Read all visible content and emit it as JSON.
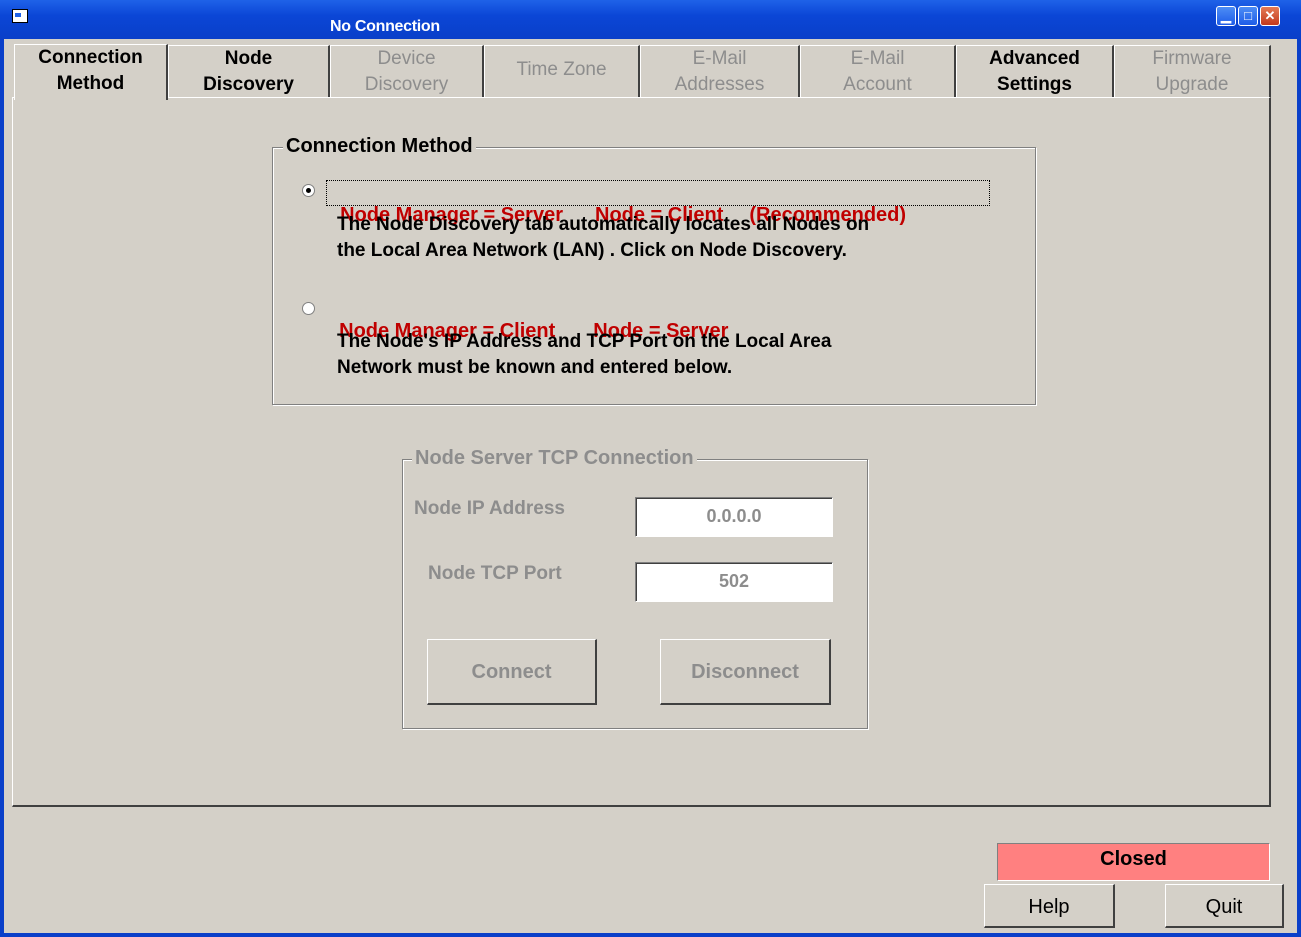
{
  "window": {
    "title": "No Connection"
  },
  "tabs": [
    {
      "label": "Connection Method",
      "line1": "Connection",
      "line2": "Method",
      "state": "active"
    },
    {
      "label": "Node Discovery",
      "line1": "Node",
      "line2": "Discovery",
      "state": "enabled"
    },
    {
      "label": "Device Discovery",
      "line1": "Device",
      "line2": "Discovery",
      "state": "disabled"
    },
    {
      "label": "Time Zone",
      "line1": "Time Zone",
      "line2": "",
      "state": "disabled"
    },
    {
      "label": "E-Mail Addresses",
      "line1": "E-Mail",
      "line2": "Addresses",
      "state": "disabled"
    },
    {
      "label": "E-Mail Account",
      "line1": "E-Mail",
      "line2": "Account",
      "state": "disabled"
    },
    {
      "label": "Advanced Settings",
      "line1": "Advanced",
      "line2": "Settings",
      "state": "enabled"
    },
    {
      "label": "Firmware Upgrade",
      "line1": "Firmware",
      "line2": "Upgrade",
      "state": "disabled"
    }
  ],
  "connection_method": {
    "title": "Connection Method",
    "option1": {
      "part1": "Node Manager = Server",
      "part2": "Node = Client",
      "part3": "(Recommended)",
      "desc_line1": "The Node Discovery tab automatically locates all Nodes on",
      "desc_line2": "the Local Area Network (LAN) .  Click on Node Discovery.",
      "checked": true
    },
    "option2": {
      "part1": "Node Manager = Client",
      "part2": "Node = Server",
      "desc_line1": "The Node's IP Address and TCP Port on the Local Area",
      "desc_line2": "Network must be known and entered below.",
      "checked": false
    }
  },
  "tcp_connection": {
    "title": "Node Server TCP Connection",
    "ip_label": "Node IP Address",
    "ip_value": "0.0.0.0",
    "port_label": "Node TCP Port",
    "port_value": "502",
    "connect_label": "Connect",
    "disconnect_label": "Disconnect"
  },
  "footer": {
    "status": "Closed",
    "status_color": "#ff8080",
    "help_label": "Help",
    "quit_label": "Quit"
  }
}
